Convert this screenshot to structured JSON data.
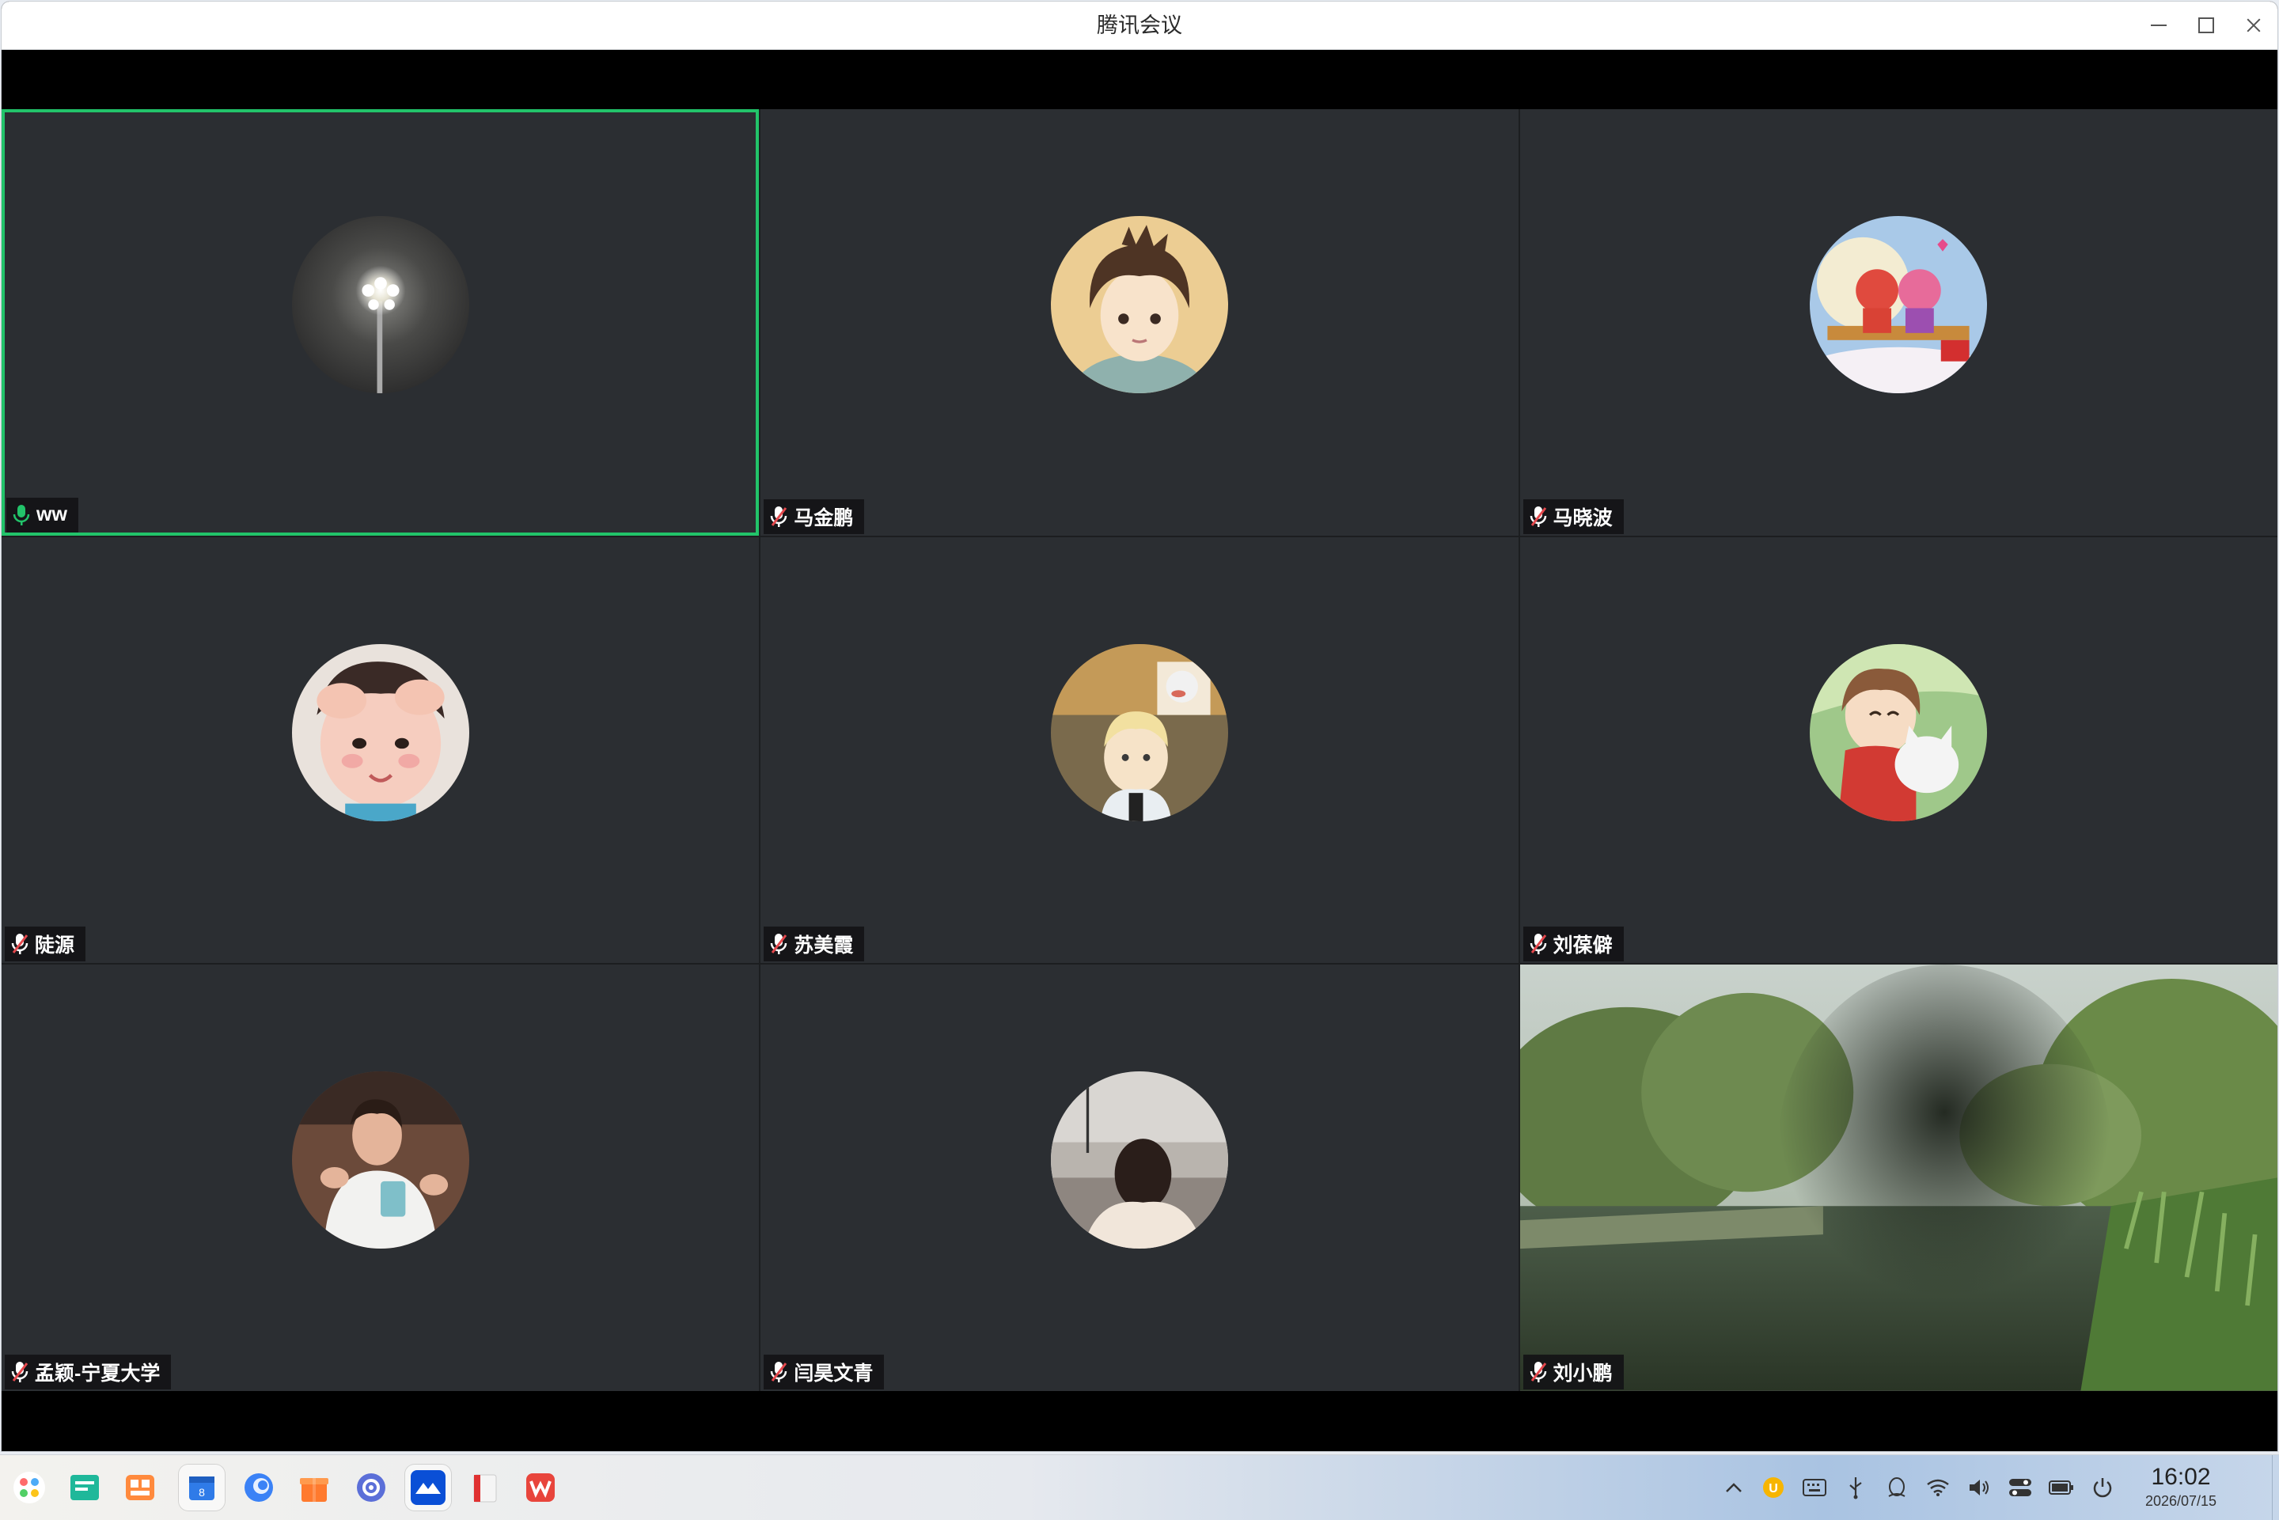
{
  "window": {
    "title": "腾讯会议"
  },
  "participants": [
    {
      "name": "ww",
      "mic": "on",
      "active": true,
      "avatar": "streetlight-night-icon"
    },
    {
      "name": "马金鹏",
      "mic": "muted",
      "active": false,
      "avatar": "anime-boy-icon"
    },
    {
      "name": "马晓波",
      "mic": "muted",
      "active": false,
      "avatar": "cartoon-couple-icon"
    },
    {
      "name": "陡源",
      "mic": "muted",
      "active": false,
      "avatar": "child-photo-icon"
    },
    {
      "name": "苏美霞",
      "mic": "muted",
      "active": false,
      "avatar": "anime-cat-icon"
    },
    {
      "name": "刘葆僻",
      "mic": "muted",
      "active": false,
      "avatar": "anime-boy-cat-icon"
    },
    {
      "name": "孟颖-宁夏大学",
      "mic": "muted",
      "active": false,
      "avatar": "man-photo-icon"
    },
    {
      "name": "闫昊文青",
      "mic": "muted",
      "active": false,
      "avatar": "girl-lake-icon"
    },
    {
      "name": "刘小鹏",
      "mic": "muted",
      "active": false,
      "video": "park-pond-video"
    }
  ],
  "colors": {
    "active_border": "#22c36a",
    "tile_bg": "#2b2e32",
    "mic_on": "#22c36a",
    "mic_muted": "#e5484d"
  },
  "taskbar": {
    "apps": [
      "launcher-icon",
      "files-icon",
      "app-store-icon",
      "calendar-icon",
      "browser-icon",
      "gift-box-icon",
      "settings-icon",
      "meeting-app-icon",
      "reader-icon",
      "wps-icon"
    ],
    "tray": [
      "chevron-up-icon",
      "input-method-icon",
      "keyboard-icon",
      "usb-icon",
      "qq-icon",
      "wifi-icon",
      "volume-icon",
      "toggle-icon",
      "battery-icon",
      "power-icon"
    ],
    "time": "16:02",
    "date": "2026/07/15"
  }
}
